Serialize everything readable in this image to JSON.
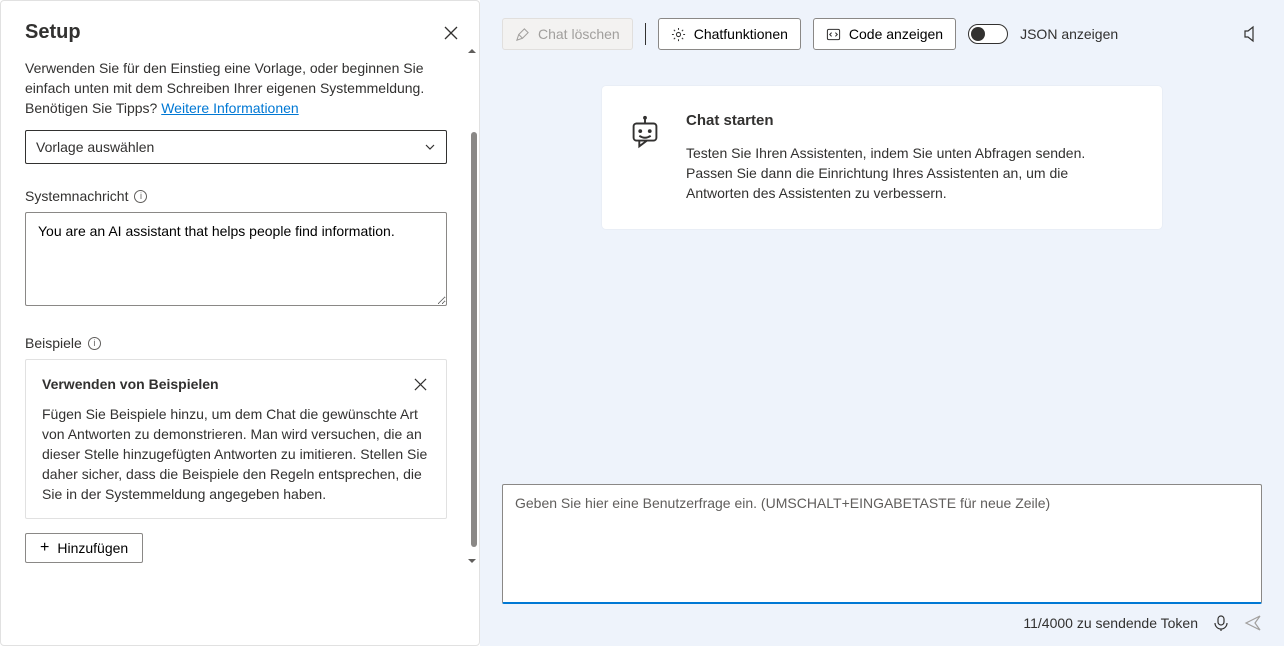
{
  "setup": {
    "title": "Setup",
    "intro_prefix": "Verwenden Sie für den Einstieg eine Vorlage, oder beginnen Sie einfach unten mit dem Schreiben Ihrer eigenen Systemmeldung. Benötigen Sie Tipps? ",
    "intro_link": "Weitere Informationen",
    "template_placeholder": "Vorlage auswählen",
    "system_message_label": "Systemnachricht",
    "system_message_value": "You are an AI assistant that helps people find information.",
    "examples_label": "Beispiele",
    "examples_card_title": "Verwenden von Beispielen",
    "examples_card_body": "Fügen Sie Beispiele hinzu, um dem Chat die gewünschte Art von Antworten zu demonstrieren. Man wird versuchen, die an dieser Stelle hinzugefügten Antworten zu imitieren. Stellen Sie daher sicher, dass die Beispiele den Regeln entsprechen, die Sie in der Systemmeldung angegeben haben.",
    "add_button": "Hinzufügen"
  },
  "toolbar": {
    "clear_chat": "Chat löschen",
    "chat_functions": "Chatfunktionen",
    "show_code": "Code anzeigen",
    "show_json": "JSON anzeigen"
  },
  "chat": {
    "start_title": "Chat starten",
    "start_body": "Testen Sie Ihren Assistenten, indem Sie unten Abfragen senden. Passen Sie dann die Einrichtung Ihres Assistenten an, um die Antworten des Assistenten zu verbessern.",
    "input_placeholder": "Geben Sie hier eine Benutzerfrage ein. (UMSCHALT+EINGABETASTE für neue Zeile)",
    "token_counter": "11/4000 zu sendende Token"
  }
}
